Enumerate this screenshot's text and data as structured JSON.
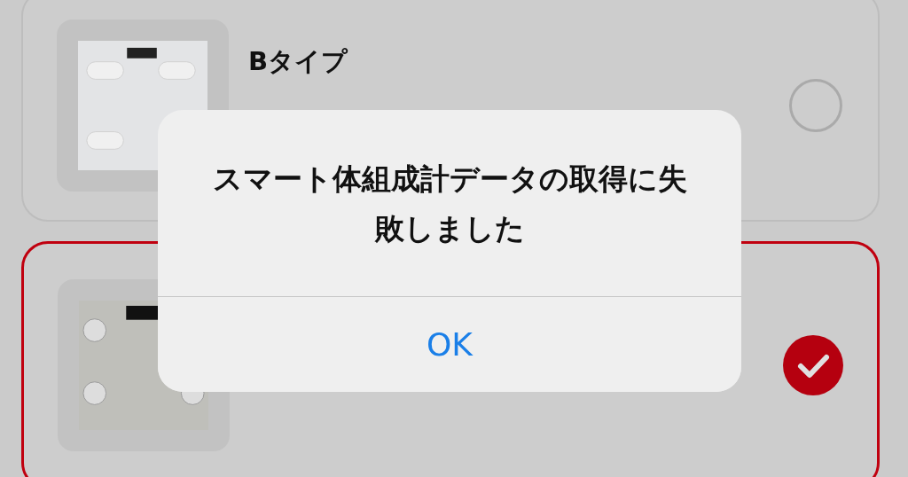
{
  "cards": [
    {
      "title": "Bタイプ",
      "selected": false,
      "kind": "pads"
    },
    {
      "selected": true,
      "kind": "electrodes"
    }
  ],
  "alert": {
    "title": "スマート体組成計データの取得に失敗しました",
    "buttons": [
      "OK"
    ]
  }
}
